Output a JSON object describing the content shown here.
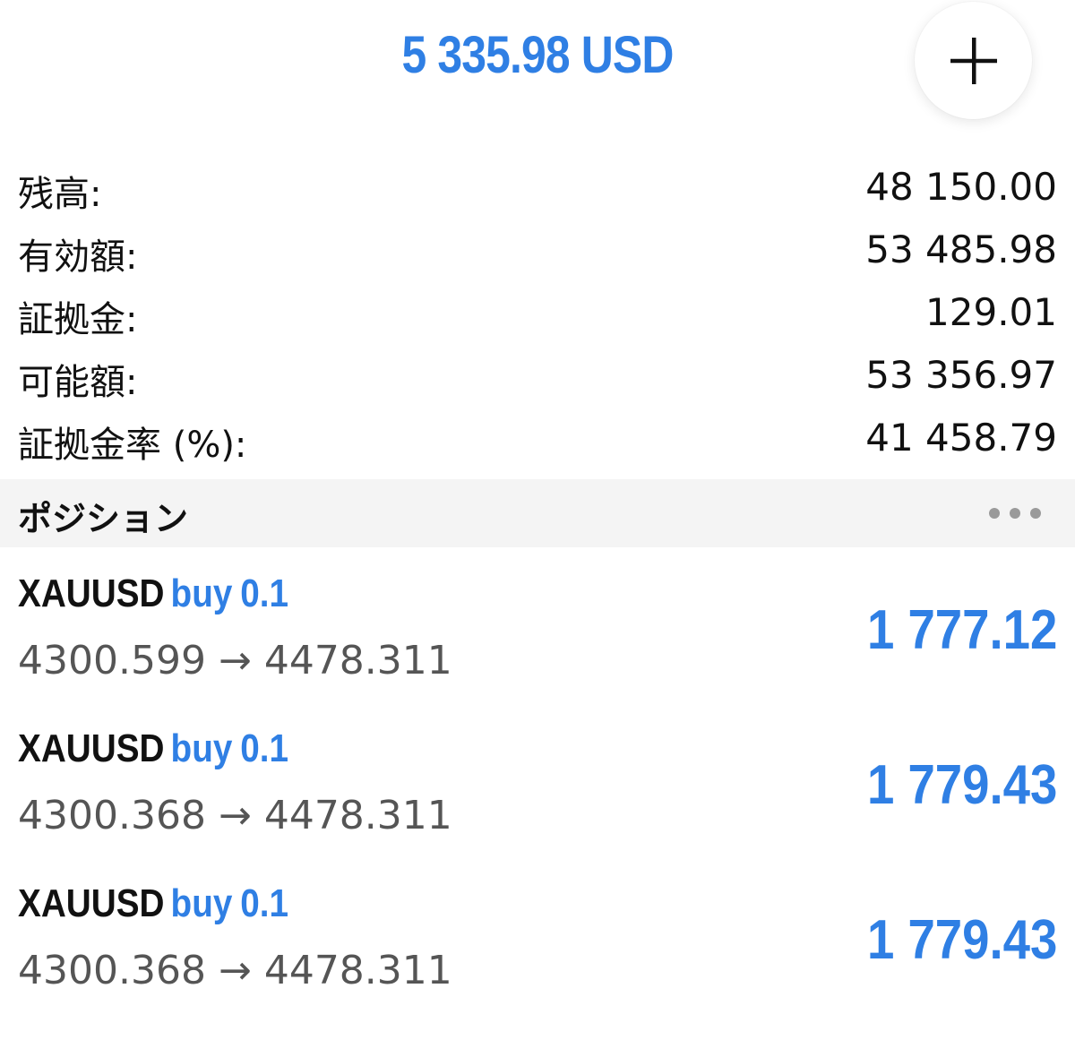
{
  "header": {
    "total_profit": "5 335.98 USD",
    "add_icon": "plus-icon",
    "accent_color": "#2f7fe4"
  },
  "account": {
    "rows": [
      {
        "label": "残高:",
        "value": "48 150.00"
      },
      {
        "label": "有効額:",
        "value": "53 485.98"
      },
      {
        "label": "証拠金:",
        "value": "129.01"
      },
      {
        "label": "可能額:",
        "value": "53 356.97"
      },
      {
        "label": "証拠金率 (%):",
        "value": "41 458.79"
      }
    ]
  },
  "positions_section": {
    "title": "ポジション",
    "more_icon": "more-dots-icon"
  },
  "positions": [
    {
      "symbol": "XAUUSD",
      "side": "buy",
      "volume": "0.1",
      "open_price": "4300.599",
      "arrow": "→",
      "current_price": "4478.311",
      "profit": "1 777.12"
    },
    {
      "symbol": "XAUUSD",
      "side": "buy",
      "volume": "0.1",
      "open_price": "4300.368",
      "arrow": "→",
      "current_price": "4478.311",
      "profit": "1 779.43"
    },
    {
      "symbol": "XAUUSD",
      "side": "buy",
      "volume": "0.1",
      "open_price": "4300.368",
      "arrow": "→",
      "current_price": "4478.311",
      "profit": "1 779.43"
    }
  ]
}
